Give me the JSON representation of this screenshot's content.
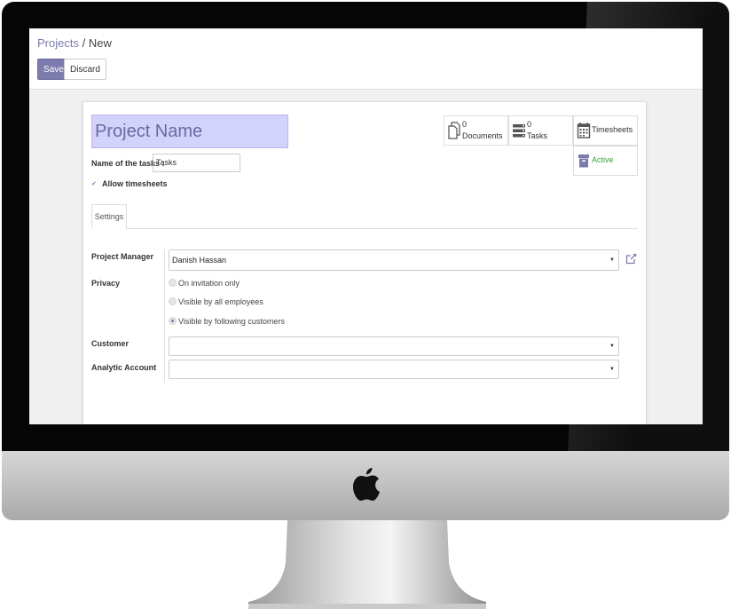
{
  "control_panel": {
    "breadcrumb_link": "Projects",
    "breadcrumb_sep": "/",
    "breadcrumb_current": "New",
    "save_label": "Save",
    "discard_label": "Discard"
  },
  "form": {
    "project_name_placeholder": "Project Name",
    "tasks_label": "Name of the tasks :",
    "tasks_value": "Tasks",
    "allow_timesheets_label": "Allow timesheets",
    "allow_timesheets_checked": true
  },
  "stat_buttons": {
    "documents_count": "0",
    "documents_label": "Documents",
    "tasks_count": "0",
    "tasks_label": "Tasks",
    "timesheets_label": "Timesheets",
    "active_label": "Active"
  },
  "tabs": [
    "Settings"
  ],
  "settings": {
    "project_manager_label": "Project Manager",
    "project_manager_value": "Danish Hassan",
    "privacy_label": "Privacy",
    "privacy_options": [
      "On invitation only",
      "Visible by all employees",
      "Visible by following customers"
    ],
    "privacy_selected": "Visible by following customers",
    "customer_label": "Customer",
    "customer_value": "",
    "analytic_account_label": "Analytic Account",
    "analytic_account_value": ""
  },
  "colors": {
    "accent": "#7c7bad",
    "title_bg": "#d2d2fb",
    "active_green": "#3aa33a"
  },
  "icons": {
    "documents": "documents-icon",
    "tasks": "tasks-icon",
    "timesheets": "calendar-icon",
    "active": "archive-icon",
    "external_link": "external-link-icon",
    "device": "apple-logo-icon"
  }
}
